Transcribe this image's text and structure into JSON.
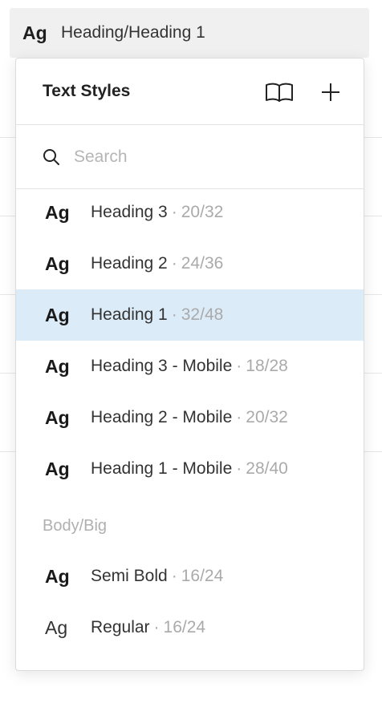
{
  "selector": {
    "ag": "Ag",
    "current_style": "Heading/Heading 1"
  },
  "panel": {
    "title": "Text Styles",
    "library_icon": "book-icon",
    "add_icon": "plus-icon"
  },
  "search": {
    "placeholder": "Search",
    "value": ""
  },
  "styles": [
    {
      "ag": "Ag",
      "name": "Heading 3",
      "sep": "·",
      "meta": "20/32",
      "selected": false
    },
    {
      "ag": "Ag",
      "name": "Heading 2",
      "sep": "·",
      "meta": "24/36",
      "selected": false
    },
    {
      "ag": "Ag",
      "name": "Heading 1",
      "sep": "·",
      "meta": "32/48",
      "selected": true
    },
    {
      "ag": "Ag",
      "name": "Heading 3 - Mobile",
      "sep": "·",
      "meta": "18/28",
      "selected": false
    },
    {
      "ag": "Ag",
      "name": "Heading 2 - Mobile",
      "sep": "·",
      "meta": "20/32",
      "selected": false
    },
    {
      "ag": "Ag",
      "name": "Heading 1 - Mobile",
      "sep": "·",
      "meta": "28/40",
      "selected": false
    }
  ],
  "body_group": {
    "label": "Body/Big",
    "styles": [
      {
        "ag": "Ag",
        "name": "Semi Bold",
        "sep": "·",
        "meta": "16/24",
        "weight": "bold"
      },
      {
        "ag": "Ag",
        "name": "Regular",
        "sep": "·",
        "meta": "16/24",
        "weight": "regular"
      }
    ]
  },
  "colors": {
    "selected_row": "#dcebf8",
    "meta_text": "#aaaaaa",
    "selector_bg": "#f0f0f0"
  }
}
